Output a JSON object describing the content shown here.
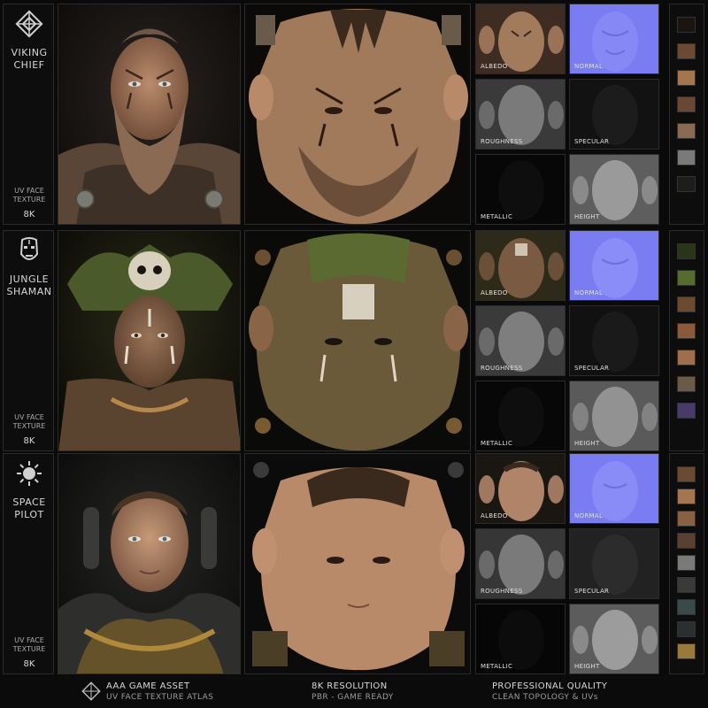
{
  "characters": [
    {
      "emblem_icon": "celtic-knot-icon",
      "name": "VIKING\nCHIEF",
      "uv_label": "UV FACE\nTEXTURE",
      "resolution": "8K",
      "maps": [
        "ALBEDO",
        "NORMAL",
        "ROUGHNESS",
        "SPECULAR",
        "METALLIC",
        "HEIGHT"
      ],
      "palette": [
        "#1c1410",
        "#6a4a33",
        "#a5754f",
        "#6a4735",
        "#8a6a55",
        "#7a7a78",
        "#1d1d1b",
        "#222218",
        "#3a3a30"
      ]
    },
    {
      "emblem_icon": "tribal-mask-icon",
      "name": "JUNGLE\nSHAMAN",
      "uv_label": "UV FACE\nTEXTURE",
      "resolution": "8K",
      "maps": [
        "ALBEDO",
        "NORMAL",
        "ROUGHNESS",
        "SPECULAR",
        "METALLIC",
        "HEIGHT"
      ],
      "palette": [
        "#2a3419",
        "#556b2f",
        "#6b4a30",
        "#8a5a3a",
        "#a06e4a",
        "#6b5a4a",
        "#4a3a6a",
        "#5a5a9a"
      ]
    },
    {
      "emblem_icon": "sun-compass-icon",
      "name": "SPACE\nPILOT",
      "uv_label": "UV FACE\nTEXTURE",
      "resolution": "8K",
      "maps": [
        "ALBEDO",
        "NORMAL",
        "ROUGHNESS",
        "SPECULAR",
        "METALLIC",
        "HEIGHT"
      ],
      "palette": [
        "#6a4a33",
        "#a5754f",
        "#8a6045",
        "#5a4030",
        "#7a7a78",
        "#3a3a38",
        "#3a4a4a",
        "#2a3030",
        "#9a7a3a"
      ]
    }
  ],
  "footer": {
    "icon": "celtic-knot-icon",
    "col1_top": "AAA GAME ASSET",
    "col1_bottom": "UV FACE TEXTURE ATLAS",
    "col2_top": "8K RESOLUTION",
    "col2_bottom": "PBR - GAME READY",
    "col3_top": "PROFESSIONAL QUALITY",
    "col3_bottom": "CLEAN TOPOLOGY & UVs"
  }
}
